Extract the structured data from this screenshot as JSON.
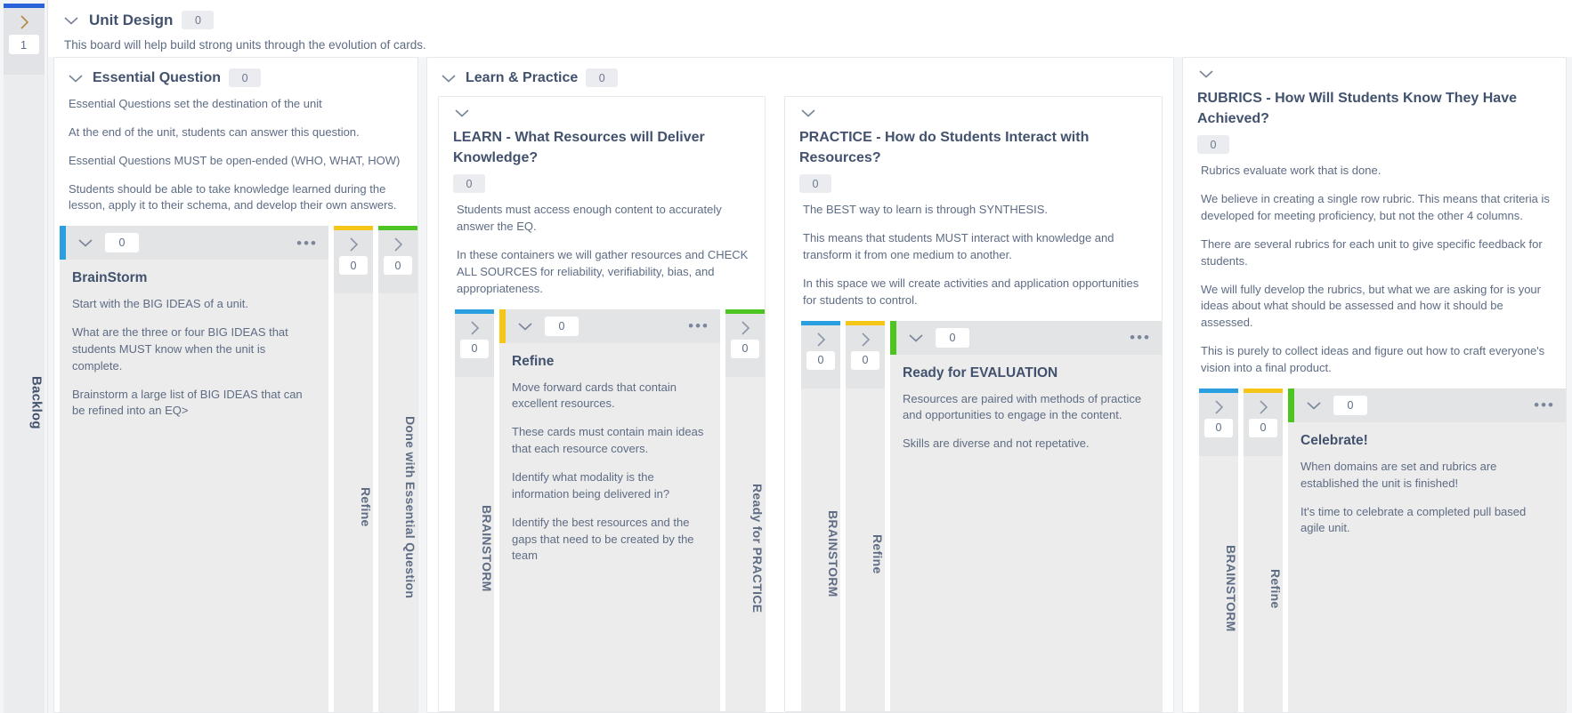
{
  "rail": {
    "badge": "1",
    "title": "Backlog",
    "expand_icon": "chevron-right-icon"
  },
  "board": {
    "title": "Unit Design",
    "count": "0",
    "description": "This board will help build strong units through the evolution of cards."
  },
  "lanes": [
    {
      "id": "essential-question",
      "name": "Essential Question",
      "count": "0",
      "description": [
        "Essential Questions set the destination of the unit",
        "At the end of the unit, students can answer this question.",
        "Essential Questions MUST be open-ended (WHO, WHAT, HOW)",
        "Students should be able to take knowledge learned during the lesson, apply it to their schema, and develop their own answers."
      ],
      "open_column": {
        "stripe": "blue",
        "count": "0",
        "menu_icon": "ellipsis-icon",
        "card_title": "BrainStorm",
        "card_body": [
          "Start with the BIG IDEAS of a unit.",
          "What are the three or four BIG IDEAS that students MUST know when the unit is complete.",
          "Brainstorm a large list of BIG IDEAS that can be refined into an EQ>"
        ]
      },
      "collapsed_columns": [
        {
          "label": "Refine",
          "count": "0",
          "stripe": "yellow"
        },
        {
          "label": "Done with Essential Question",
          "count": "0",
          "stripe": "green"
        }
      ]
    },
    {
      "id": "learn-and-practice",
      "name": "Learn & Practice",
      "count": "0",
      "sublanes": [
        {
          "id": "learn",
          "title": "LEARN - What Resources will Deliver Knowledge?",
          "count": "0",
          "description": [
            "Students must access enough content to accurately answer the EQ.",
            "In these containers we will gather resources and CHECK ALL SOURCES for reliability, verifiability, bias, and appropriateness."
          ],
          "leading_collapsed": [
            {
              "label": "BRAINSTORM",
              "count": "0",
              "stripe": "blue"
            }
          ],
          "open_column": {
            "stripe": "yellow",
            "count": "0",
            "menu_icon": "ellipsis-icon",
            "card_title": "Refine",
            "card_body": [
              "Move forward cards that contain excellent resources.",
              "These cards must contain main ideas that each resource covers.",
              "Identify what modality is the information being delivered in?",
              "Identify the best resources and the gaps that need to be created by the team"
            ]
          },
          "trailing_collapsed": [
            {
              "label": "Ready for PRACTICE",
              "count": "0",
              "stripe": "green"
            }
          ]
        },
        {
          "id": "practice",
          "title": "PRACTICE - How do Students Interact with Resources?",
          "count": "0",
          "description": [
            "The BEST way to learn is through SYNTHESIS.",
            "This means that students MUST interact with knowledge and transform it from one medium to another.",
            "In this space we will create activities and application opportunities for students to control."
          ],
          "leading_collapsed": [
            {
              "label": "BRAINSTORM",
              "count": "0",
              "stripe": "blue"
            },
            {
              "label": "Refine",
              "count": "0",
              "stripe": "yellow"
            }
          ],
          "open_column": {
            "stripe": "green",
            "count": "0",
            "menu_icon": "ellipsis-icon",
            "card_title": "Ready for EVALUATION",
            "card_body": [
              "Resources are paired with methods of practice and opportunities to engage in the content.",
              "Skills are diverse and not repetative."
            ]
          },
          "trailing_collapsed": []
        }
      ]
    },
    {
      "id": "rubrics",
      "title": "RUBRICS - How Will Students Know They Have Achieved?",
      "count": "0",
      "description": [
        "Rubrics evaluate work that is done.",
        "We believe in creating a single row rubric. This means that criteria is developed for meeting proficiency, but not the other 4 columns.",
        "There are several rubrics for each unit to give specific feedback for students.",
        "We will fully develop the rubrics, but what we are asking for is your ideas about what should be assessed and how it should be assessed.",
        "This is purely to collect ideas and figure out how to craft everyone's vision into a final product."
      ],
      "leading_collapsed": [
        {
          "label": "BRAINSTORM",
          "count": "0",
          "stripe": "blue"
        },
        {
          "label": "Refine",
          "count": "0",
          "stripe": "yellow"
        }
      ],
      "open_column": {
        "stripe": "green",
        "count": "0",
        "menu_icon": "ellipsis-icon",
        "card_title": "Celebrate!",
        "card_body": [
          "When domains are set and rubrics are established the unit is finished!",
          "It's time to celebrate a completed pull based agile unit."
        ]
      }
    }
  ],
  "colors": {
    "brainstorm": "#2a9fe0",
    "refine": "#f5c518",
    "done": "#4cc421",
    "rail_accent": "#2b62d9"
  }
}
